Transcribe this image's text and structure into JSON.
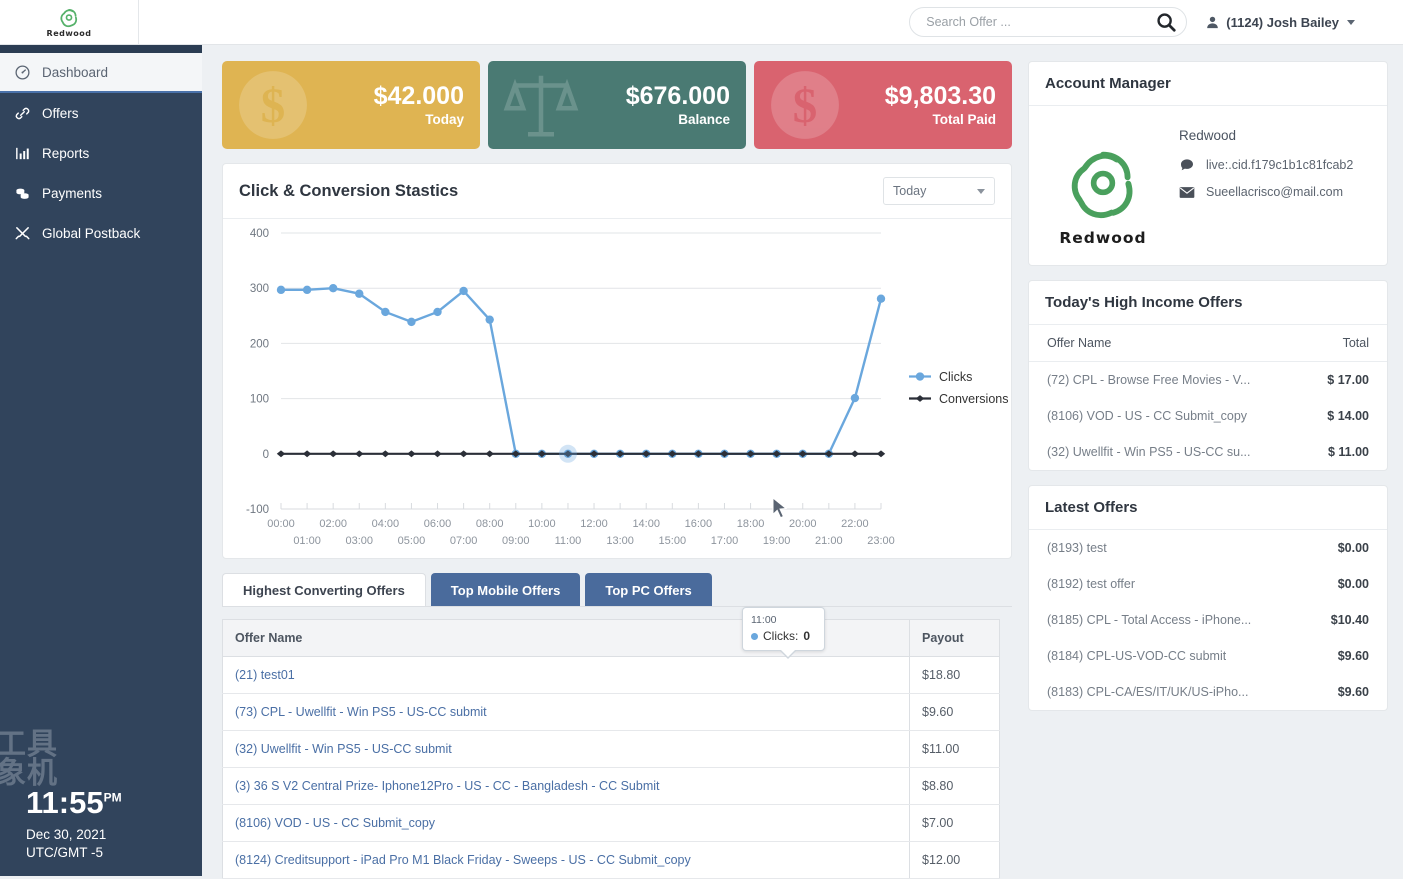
{
  "header": {
    "brand_name": "Redwood",
    "search": {
      "placeholder": "Search Offer ...",
      "value": ""
    },
    "user": "(1124) Josh Bailey"
  },
  "sidebar": {
    "items": [
      {
        "label": "Dashboard",
        "icon": "speedometer-icon",
        "active": true
      },
      {
        "label": "Offers",
        "icon": "link-icon",
        "active": false
      },
      {
        "label": "Reports",
        "icon": "bar-chart-icon",
        "active": false
      },
      {
        "label": "Payments",
        "icon": "coins-icon",
        "active": false
      },
      {
        "label": "Global Postback",
        "icon": "tools-icon",
        "active": false
      }
    ],
    "clock": {
      "time": "11:55",
      "ampm": "PM",
      "date": "Dec 30, 2021",
      "timezone": "UTC/GMT -5",
      "watermark": "工具\n象机"
    }
  },
  "stats": [
    {
      "value": "$42.000",
      "label": "Today",
      "color": "#dfb452",
      "icon": "dollar-icon"
    },
    {
      "value": "$676.000",
      "label": "Balance",
      "color": "#4a7a73",
      "icon": "scales-icon"
    },
    {
      "value": "$9,803.30",
      "label": "Total Paid",
      "color": "#d9636f",
      "icon": "dollar-icon"
    }
  ],
  "chart_panel": {
    "title": "Click & Conversion Stastics",
    "range_selector": {
      "value": "Today",
      "icon": "chevron-down-icon"
    },
    "tooltip": {
      "time": "11:00",
      "label": "Clicks:",
      "value": "0"
    }
  },
  "chart_data": {
    "type": "line",
    "title": "Click & Conversion Stastics",
    "xlabel": "",
    "ylabel": "",
    "ylim": [
      -100,
      400
    ],
    "yticks": [
      400,
      300,
      200,
      100,
      0,
      -100
    ],
    "grid": true,
    "legend_position": "right",
    "x": [
      "00:00",
      "01:00",
      "02:00",
      "03:00",
      "04:00",
      "05:00",
      "06:00",
      "07:00",
      "08:00",
      "09:00",
      "10:00",
      "11:00",
      "12:00",
      "13:00",
      "14:00",
      "15:00",
      "16:00",
      "17:00",
      "18:00",
      "19:00",
      "20:00",
      "21:00",
      "22:00",
      "23:00"
    ],
    "series": [
      {
        "name": "Clicks",
        "color": "#6aa7dd",
        "values": [
          297,
          297,
          300,
          290,
          257,
          239,
          257,
          295,
          243,
          0,
          0,
          0,
          0,
          0,
          0,
          0,
          0,
          0,
          0,
          0,
          0,
          0,
          101,
          281
        ]
      },
      {
        "name": "Conversions",
        "color": "#2b2f38",
        "values": [
          0,
          0,
          0,
          0,
          0,
          0,
          0,
          0,
          0,
          0,
          0,
          0,
          0,
          0,
          0,
          0,
          0,
          0,
          0,
          0,
          0,
          0,
          0,
          0
        ]
      }
    ]
  },
  "tabs": [
    {
      "label": "Highest Converting Offers",
      "active": true
    },
    {
      "label": "Top Mobile Offers",
      "active": false
    },
    {
      "label": "Top PC Offers",
      "active": false
    }
  ],
  "offer_table": {
    "columns": [
      "Offer Name",
      "Payout"
    ],
    "rows": [
      {
        "name": "(21) test01",
        "payout": "$18.80"
      },
      {
        "name": "(73) CPL - Uwellfit - Win PS5 - US-CC submit",
        "payout": "$9.60"
      },
      {
        "name": "(32) Uwellfit - Win PS5 - US-CC submit",
        "payout": "$11.00"
      },
      {
        "name": "(3) 36 S V2 Central Prize- Iphone12Pro - US - CC - Bangladesh - CC Submit",
        "payout": "$8.80"
      },
      {
        "name": "(8106) VOD - US - CC Submit_copy",
        "payout": "$7.00"
      },
      {
        "name": "(8124) Creditsupport - iPad Pro M1 Black Friday - Sweeps - US - CC Submit_copy",
        "payout": "$12.00"
      }
    ]
  },
  "account_manager": {
    "title": "Account Manager",
    "company": "Redwood",
    "manager_name": "Redwood",
    "skype": "live:.cid.f179c1b1c81fcab2",
    "email": "Sueellacrisco@mail.com"
  },
  "high_income": {
    "title": "Today's High Income Offers",
    "columns": [
      "Offer Name",
      "Total"
    ],
    "rows": [
      {
        "name": "(72) CPL - Browse Free Movies - V...",
        "total": "$ 17.00"
      },
      {
        "name": "(8106) VOD - US - CC Submit_copy",
        "total": "$ 14.00"
      },
      {
        "name": "(32) Uwellfit - Win PS5 - US-CC su...",
        "total": "$ 11.00"
      }
    ]
  },
  "latest_offers": {
    "title": "Latest Offers",
    "rows": [
      {
        "name": "(8193) test",
        "amount": "$0.00"
      },
      {
        "name": "(8192) test offer",
        "amount": "$0.00"
      },
      {
        "name": "(8185) CPL - Total Access - iPhone...",
        "amount": "$10.40"
      },
      {
        "name": "(8184) CPL-US-VOD-CC submit",
        "amount": "$9.60"
      },
      {
        "name": "(8183) CPL-CA/ES/IT/UK/US-iPho...",
        "amount": "$9.60"
      }
    ]
  }
}
